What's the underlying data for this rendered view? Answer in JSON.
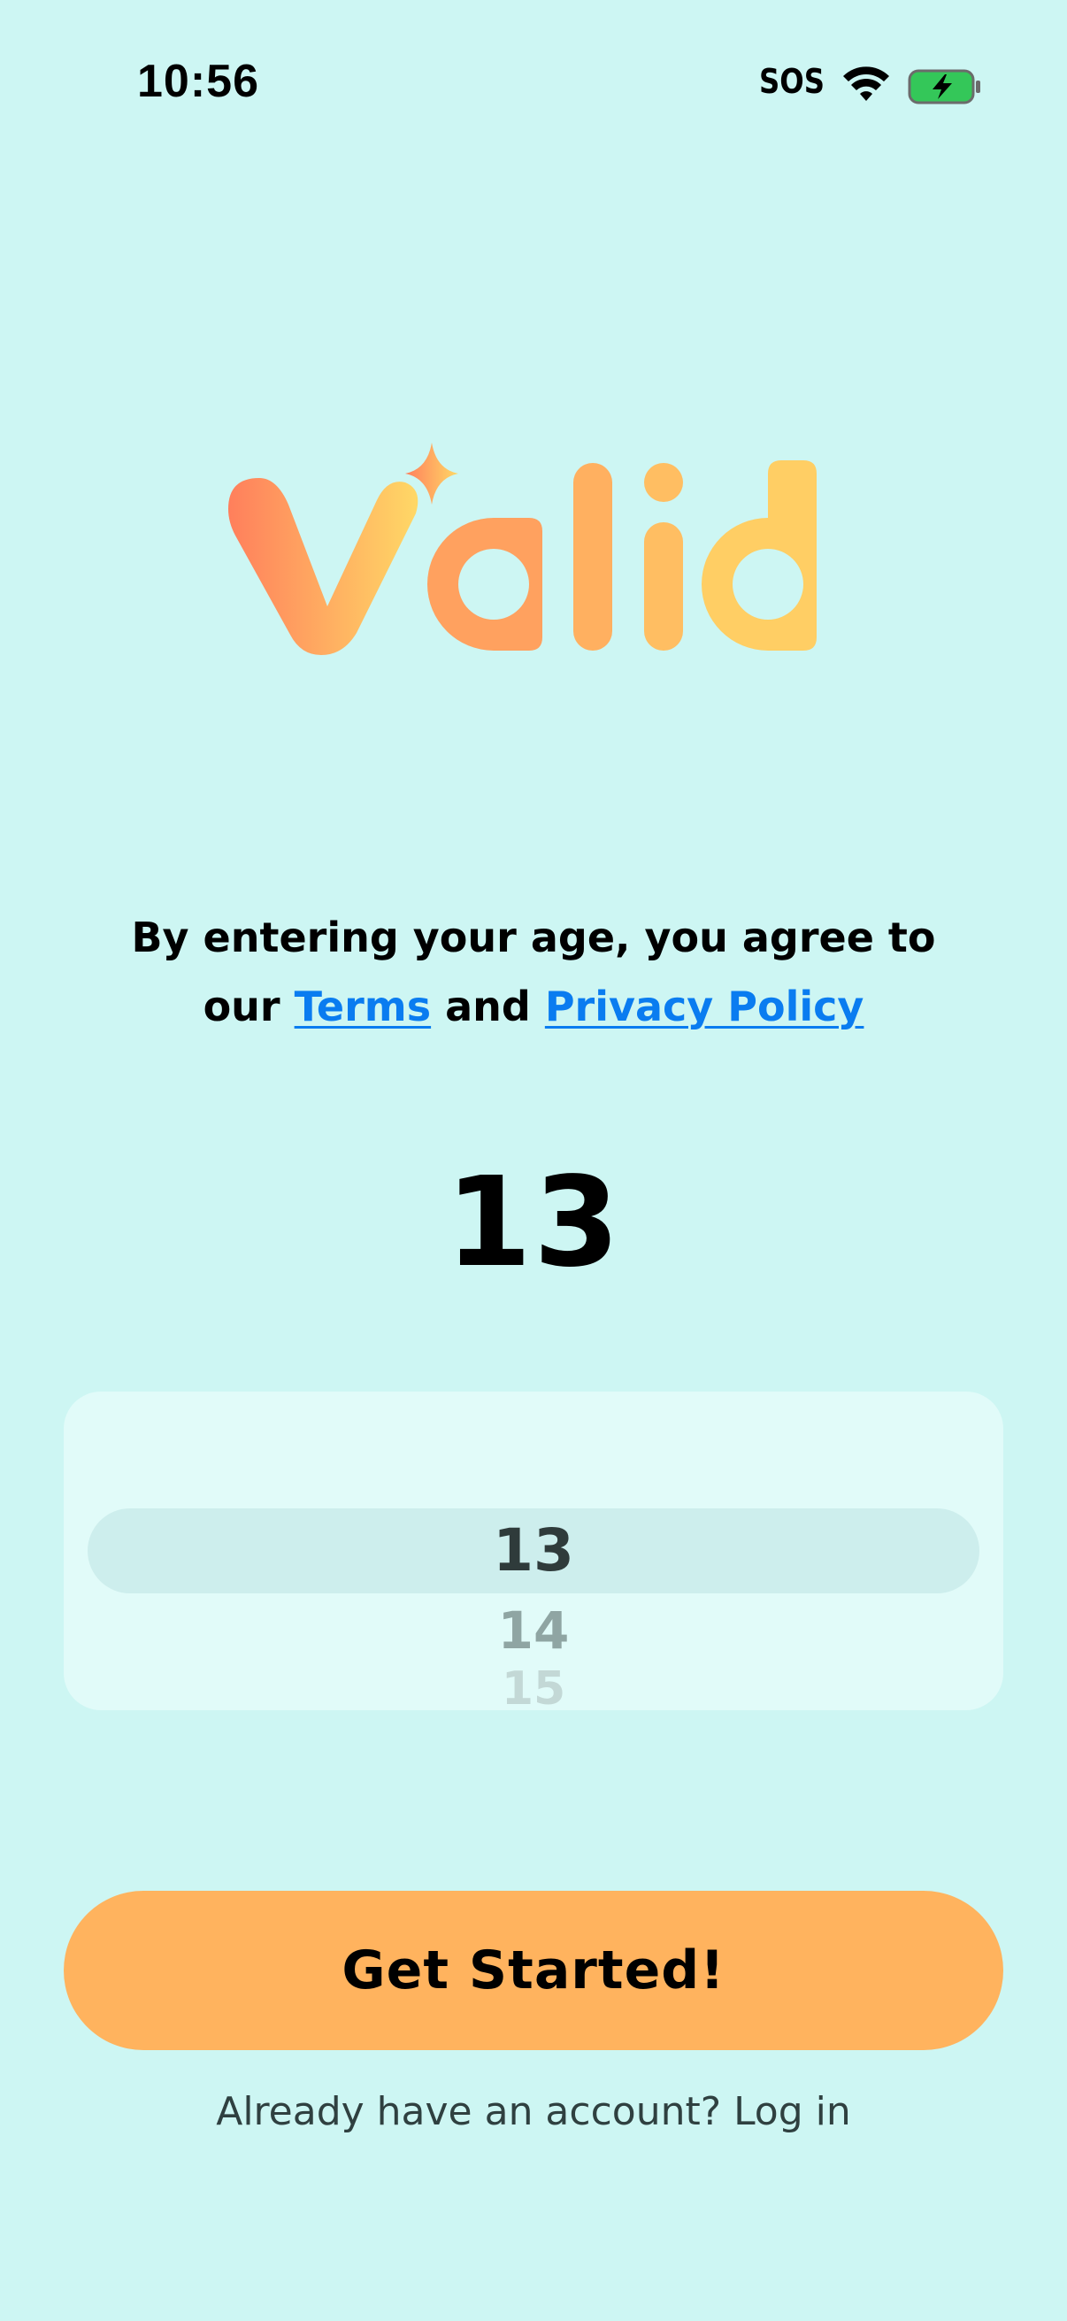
{
  "status_bar": {
    "time": "10:56",
    "carrier_text": "SOS",
    "wifi_icon": "wifi-icon",
    "battery_icon": "battery-charging-icon",
    "battery_color": "#34c759"
  },
  "logo": {
    "text": "Valid",
    "gradient_start": "#ff7f5c",
    "gradient_end": "#ffd866"
  },
  "consent": {
    "prefix": "By entering your age, you agree to our",
    "terms_link": "Terms",
    "and": "and",
    "privacy_link": "Privacy Policy",
    "link_color": "#0a7cf0"
  },
  "age": {
    "selected": "13"
  },
  "picker": {
    "options": [
      "13",
      "14",
      "15"
    ]
  },
  "cta": {
    "label": "Get Started!",
    "color": "#ffb35e"
  },
  "login": {
    "text": "Already have an account? Log in"
  },
  "background": "#cdf6f3"
}
